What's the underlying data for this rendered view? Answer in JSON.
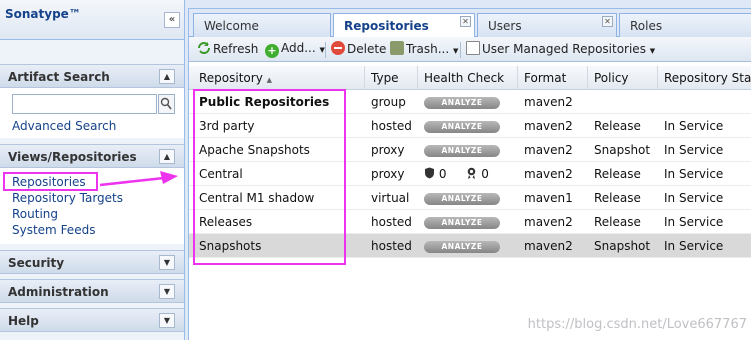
{
  "left_panel": {
    "title": "Sonatype™",
    "collapse_glyph": "«",
    "artifact_search": {
      "header": "Artifact Search",
      "search_value": "",
      "advanced_link": "Advanced Search"
    },
    "views": {
      "header": "Views/Repositories",
      "links": [
        "Repositories",
        "Repository Targets",
        "Routing",
        "System Feeds"
      ]
    },
    "security": {
      "header": "Security"
    },
    "administration": {
      "header": "Administration"
    },
    "help": {
      "header": "Help"
    }
  },
  "tabs": [
    {
      "label": "Welcome",
      "active": false
    },
    {
      "label": "Repositories",
      "active": true
    },
    {
      "label": "Users",
      "active": false
    },
    {
      "label": "Roles",
      "active": false
    }
  ],
  "toolbar": {
    "refresh": "Refresh",
    "add": "Add...",
    "delete": "Delete",
    "trash": "Trash...",
    "user_managed": "User Managed Repositories"
  },
  "grid": {
    "columns": [
      "Repository",
      "Type",
      "Health Check",
      "Format",
      "Policy",
      "Repository Status"
    ],
    "analyze_label": "ANALYZE",
    "rows": [
      {
        "name": "Public Repositories",
        "type": "group",
        "health": "analyze",
        "format": "maven2",
        "policy": "",
        "status": ""
      },
      {
        "name": "3rd party",
        "type": "hosted",
        "health": "analyze",
        "format": "maven2",
        "policy": "Release",
        "status": "In Service"
      },
      {
        "name": "Apache Snapshots",
        "type": "proxy",
        "health": "analyze",
        "format": "maven2",
        "policy": "Snapshot",
        "status": "In Service"
      },
      {
        "name": "Central",
        "type": "proxy",
        "health": "counts",
        "security_count": "0",
        "license_count": "0",
        "format": "maven2",
        "policy": "Release",
        "status": "In Service"
      },
      {
        "name": "Central M1 shadow",
        "type": "virtual",
        "health": "analyze",
        "format": "maven1",
        "policy": "Release",
        "status": "In Service"
      },
      {
        "name": "Releases",
        "type": "hosted",
        "health": "analyze",
        "format": "maven2",
        "policy": "Release",
        "status": "In Service"
      },
      {
        "name": "Snapshots",
        "type": "hosted",
        "health": "analyze",
        "format": "maven2",
        "policy": "Snapshot",
        "status": "In Service"
      }
    ]
  },
  "watermark": "https://blog.csdn.net/Love667767",
  "colors": {
    "highlight": "#ee33ee",
    "link": "#15428b",
    "selected_row": "#d9d9d9"
  }
}
